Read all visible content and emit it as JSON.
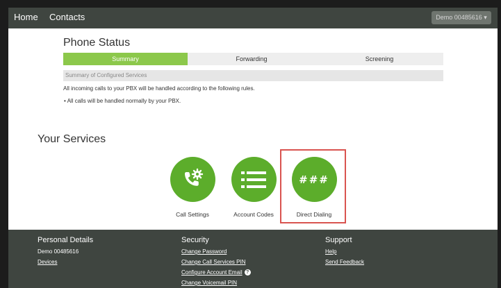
{
  "nav": {
    "home": "Home",
    "contacts": "Contacts",
    "account": "Demo 00485616 ▾"
  },
  "phone_status": {
    "title": "Phone Status",
    "tabs": [
      "Summary",
      "Forwarding",
      "Screening"
    ],
    "summary_header": "Summary of Configured Services",
    "rules_text": "All incoming calls to your PBX will be handled according to the following rules.",
    "bullet": "•  All calls will be handled normally by your PBX."
  },
  "services": {
    "title": "Your Services",
    "items": [
      {
        "label": "Call Settings",
        "icon": "phone-gear-icon"
      },
      {
        "label": "Account Codes",
        "icon": "list-icon"
      },
      {
        "label": "Direct Dialing",
        "icon": "hash-icon",
        "glyph": "###"
      }
    ]
  },
  "footer": {
    "personal": {
      "title": "Personal Details",
      "name": "Demo 00485616",
      "devices": "Devices"
    },
    "security": {
      "title": "Security",
      "links": [
        "Change Password",
        "Change Call Services PIN",
        "Configure Account Email",
        "Change Voicemail PIN"
      ]
    },
    "support": {
      "title": "Support",
      "links": [
        "Help",
        "Send Feedback"
      ]
    }
  },
  "colors": {
    "accent": "#8cc84b",
    "service_green": "#5cad2b",
    "dark": "#3f4540",
    "highlight": "#d9534f"
  }
}
